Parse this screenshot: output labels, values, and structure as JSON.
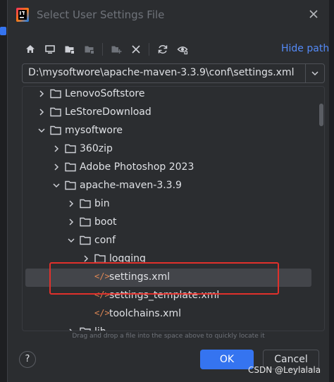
{
  "dialog": {
    "title": "Select User Settings File",
    "app_icon": "intellij-icon",
    "close_icon": "close-icon"
  },
  "toolbar": {
    "icons": [
      "home-icon",
      "desktop-icon",
      "project-folder-icon",
      "module-folder-icon",
      "new-folder-icon",
      "delete-icon",
      "refresh-icon",
      "show-hidden-icon"
    ],
    "hide_path_label": "Hide path"
  },
  "path": {
    "value": "D:\\mysoftwore\\apache-maven-3.3.9\\conf\\settings.xml"
  },
  "tree": {
    "items": [
      {
        "label": "LenovoSoftstore",
        "type": "folder",
        "expanded": false
      },
      {
        "label": "LeStoreDownload",
        "type": "folder",
        "expanded": false
      },
      {
        "label": "mysoftwore",
        "type": "folder",
        "expanded": true
      },
      {
        "label": "360zip",
        "type": "folder",
        "expanded": false
      },
      {
        "label": "Adobe Photoshop 2023",
        "type": "folder",
        "expanded": false
      },
      {
        "label": "apache-maven-3.3.9",
        "type": "folder",
        "expanded": true
      },
      {
        "label": "bin",
        "type": "folder",
        "expanded": false
      },
      {
        "label": "boot",
        "type": "folder",
        "expanded": false
      },
      {
        "label": "conf",
        "type": "folder",
        "expanded": true
      },
      {
        "label": "logging",
        "type": "folder",
        "expanded": false
      },
      {
        "label": "settings.xml",
        "type": "xml",
        "selected": true
      },
      {
        "label": "settings_template.xml",
        "type": "xml"
      },
      {
        "label": "toolchains.xml",
        "type": "xml"
      },
      {
        "label": "lib",
        "type": "folder",
        "expanded": false
      }
    ]
  },
  "hint": "Drag and drop a file into the space above to quickly locate it",
  "buttons": {
    "help": "?",
    "ok": "OK",
    "cancel": "Cancel"
  },
  "watermark": "CSDN @Leylalala",
  "colors": {
    "accent": "#3574f0",
    "link": "#548af7",
    "highlight_box": "#e0302b",
    "xml_icon": "#e08855"
  }
}
